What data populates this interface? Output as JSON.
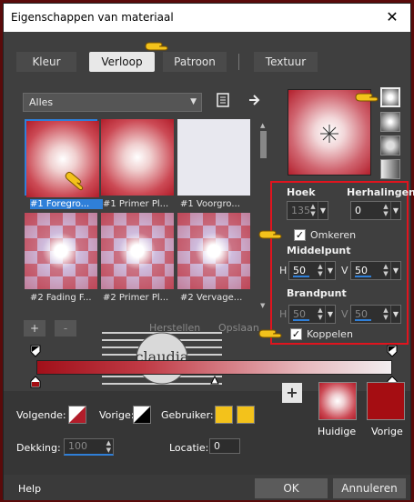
{
  "window": {
    "title": "Eigenschappen van materiaal",
    "close_glyph": "✕"
  },
  "tabs": [
    {
      "label": "Kleur"
    },
    {
      "label": "Verloop"
    },
    {
      "label": "Patroon"
    },
    {
      "label": "Textuur"
    }
  ],
  "category": {
    "selected": "Alles"
  },
  "gradients": [
    {
      "label": "#1 Foregro..."
    },
    {
      "label": "#1 Primer Pl..."
    },
    {
      "label": "#1 Voorgro..."
    },
    {
      "label": "#2 Fading F..."
    },
    {
      "label": "#2 Primer Pl..."
    },
    {
      "label": "#2 Vervage..."
    }
  ],
  "params": {
    "hoek_label": "Hoek",
    "hoek_value": "135",
    "herhalingen_label": "Herhalingen",
    "herhalingen_value": "0",
    "omkeren_label": "Omkeren",
    "middelpunt_label": "Middelpunt",
    "mid_h_label": "H",
    "mid_h_value": "50",
    "mid_v_label": "V",
    "mid_v_value": "50",
    "brandpunt_label": "Brandpunt",
    "brand_h_label": "H",
    "brand_h_value": "50",
    "brand_v_label": "V",
    "brand_v_value": "50",
    "koppelen_label": "Koppelen"
  },
  "stops_buttons": {
    "add": "+",
    "remove": "-",
    "save_hint": "Herstellen",
    "opslaan": "Opslaan"
  },
  "bottom": {
    "volgende_label": "Volgende:",
    "vorige_label": "Vorige:",
    "gebruiker_label": "Gebruiker:",
    "dekking_label": "Dekking:",
    "dekking_value": "100",
    "locatie_label": "Locatie:",
    "locatie_value": "0",
    "huidige_label": "Huidige",
    "vorige2_label": "Vorige",
    "plus_glyph": "+"
  },
  "footer": {
    "help": "Help",
    "ok": "OK",
    "cancel": "Annuleren"
  },
  "watermark": {
    "name": "claudia"
  },
  "colors": {
    "accent": "#2f7fd8",
    "highlight_border": "#e0141e",
    "vorige_swatch": "#a50d12",
    "gebruiker": "#f3c21b"
  }
}
